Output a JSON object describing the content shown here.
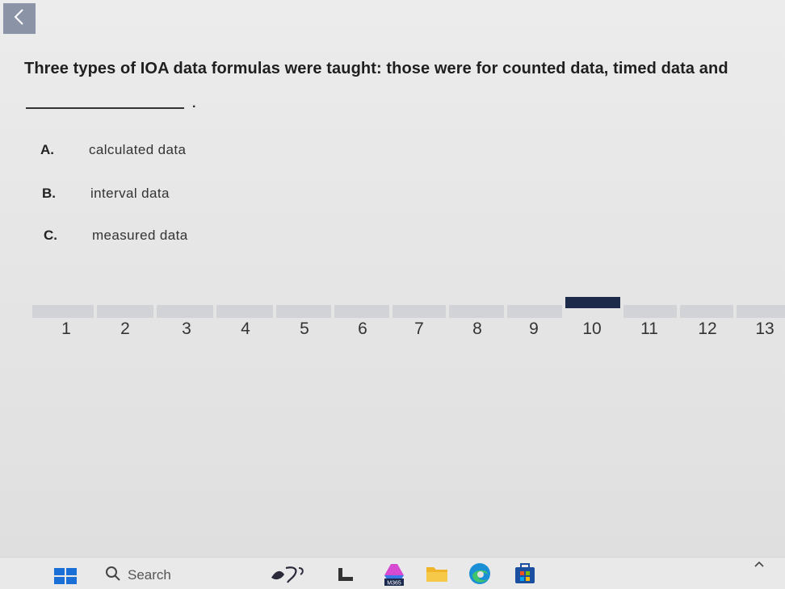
{
  "question": {
    "text": "Three types of IOA data formulas were taught: those were for counted data, timed data and",
    "blank_suffix": "."
  },
  "options": [
    {
      "letter": "A.",
      "text": "calculated data"
    },
    {
      "letter": "B.",
      "text": "interval data"
    },
    {
      "letter": "C.",
      "text": "measured data"
    }
  ],
  "navigation": {
    "pages": [
      "1",
      "2",
      "3",
      "4",
      "5",
      "6",
      "7",
      "8",
      "9",
      "10",
      "11",
      "12",
      "13"
    ],
    "current_page": "10"
  },
  "taskbar": {
    "search_label": "Search",
    "m365_badge": "M365"
  },
  "colors": {
    "active_page": "#1e2a4a",
    "inactive_page": "#d2d3d6",
    "back_button": "#8b94a6"
  },
  "icons": [
    "chevron-left-icon",
    "windows-start-icon",
    "search-icon",
    "app-icon",
    "file-explorer-icon",
    "m365-copilot-icon",
    "folder-icon",
    "edge-icon",
    "store-icon",
    "chevron-up-icon"
  ]
}
